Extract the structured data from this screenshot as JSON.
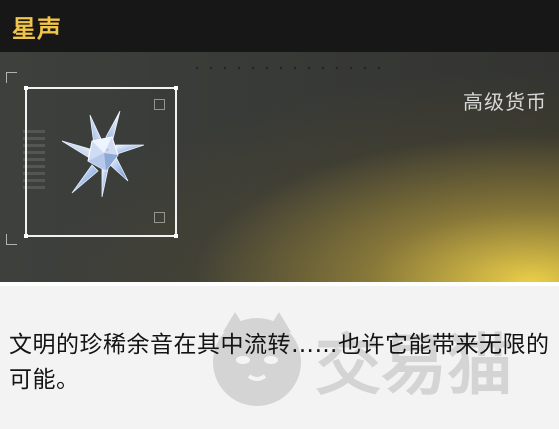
{
  "item": {
    "name": "星声",
    "type_label": "高级货币",
    "description": "文明的珍稀余音在其中流转……也许它能带来无限的可能。",
    "icon": "crystal-star-icon"
  },
  "watermark": {
    "text": "交易猫",
    "logo": "cat-face-logo"
  },
  "colors": {
    "title_text": "#f0c54b",
    "title_bar": "#171717",
    "art_background": "#3a3c39",
    "art_glow": "#f4d64a",
    "frame": "#f1f1f1",
    "description_background": "#f3f3f3",
    "description_text": "#141414"
  }
}
